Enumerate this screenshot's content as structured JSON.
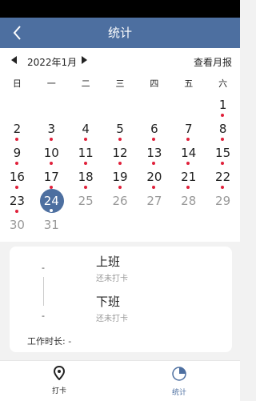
{
  "header": {
    "back_icon": "chevron-left-icon",
    "title": "统计",
    "bg_color": "#4d6fa0"
  },
  "calendar": {
    "month_label": "2022年1月",
    "report_label": "查看月报",
    "weekdays": [
      "日",
      "一",
      "二",
      "三",
      "四",
      "五",
      "六"
    ],
    "weeks": [
      [
        {
          "d": ""
        },
        {
          "d": ""
        },
        {
          "d": ""
        },
        {
          "d": ""
        },
        {
          "d": ""
        },
        {
          "d": ""
        },
        {
          "d": "1",
          "dot": true
        }
      ],
      [
        {
          "d": "2",
          "dot": true
        },
        {
          "d": "3",
          "dot": true
        },
        {
          "d": "4",
          "dot": true
        },
        {
          "d": "5",
          "dot": true
        },
        {
          "d": "6",
          "dot": true
        },
        {
          "d": "7",
          "dot": true
        },
        {
          "d": "8",
          "dot": true
        }
      ],
      [
        {
          "d": "9",
          "dot": true
        },
        {
          "d": "10",
          "dot": true
        },
        {
          "d": "11",
          "dot": true
        },
        {
          "d": "12",
          "dot": true
        },
        {
          "d": "13",
          "dot": true
        },
        {
          "d": "14",
          "dot": true
        },
        {
          "d": "15",
          "dot": true
        }
      ],
      [
        {
          "d": "16",
          "dot": true
        },
        {
          "d": "17",
          "dot": true
        },
        {
          "d": "18",
          "dot": true
        },
        {
          "d": "19",
          "dot": true
        },
        {
          "d": "20",
          "dot": true
        },
        {
          "d": "21",
          "dot": true
        },
        {
          "d": "22",
          "dot": true
        }
      ],
      [
        {
          "d": "23",
          "dot": true
        },
        {
          "d": "24",
          "today": true,
          "dot": true
        },
        {
          "d": "25",
          "gray": true
        },
        {
          "d": "26",
          "gray": true
        },
        {
          "d": "27",
          "gray": true
        },
        {
          "d": "28",
          "gray": true
        },
        {
          "d": "29",
          "gray": true
        }
      ],
      [
        {
          "d": "30",
          "gray": true
        },
        {
          "d": "31",
          "gray": true
        },
        {
          "d": ""
        },
        {
          "d": ""
        },
        {
          "d": ""
        },
        {
          "d": ""
        },
        {
          "d": ""
        }
      ]
    ],
    "dot_color": "#e0203a",
    "today_color": "#4d6fa0"
  },
  "detail": {
    "dash_top": "-",
    "dash_bottom": "-",
    "on_duty": {
      "label": "上班",
      "status": "还未打卡"
    },
    "off_duty": {
      "label": "下班",
      "status": "还未打卡"
    },
    "work_hours_label": "工作时长:",
    "work_hours_value": "-"
  },
  "tabbar": {
    "tabs": [
      {
        "label": "打卡",
        "icon": "location-pin-icon"
      },
      {
        "label": "统计",
        "icon": "pie-chart-icon",
        "active": true
      }
    ],
    "active_color": "#4d6fa0"
  }
}
